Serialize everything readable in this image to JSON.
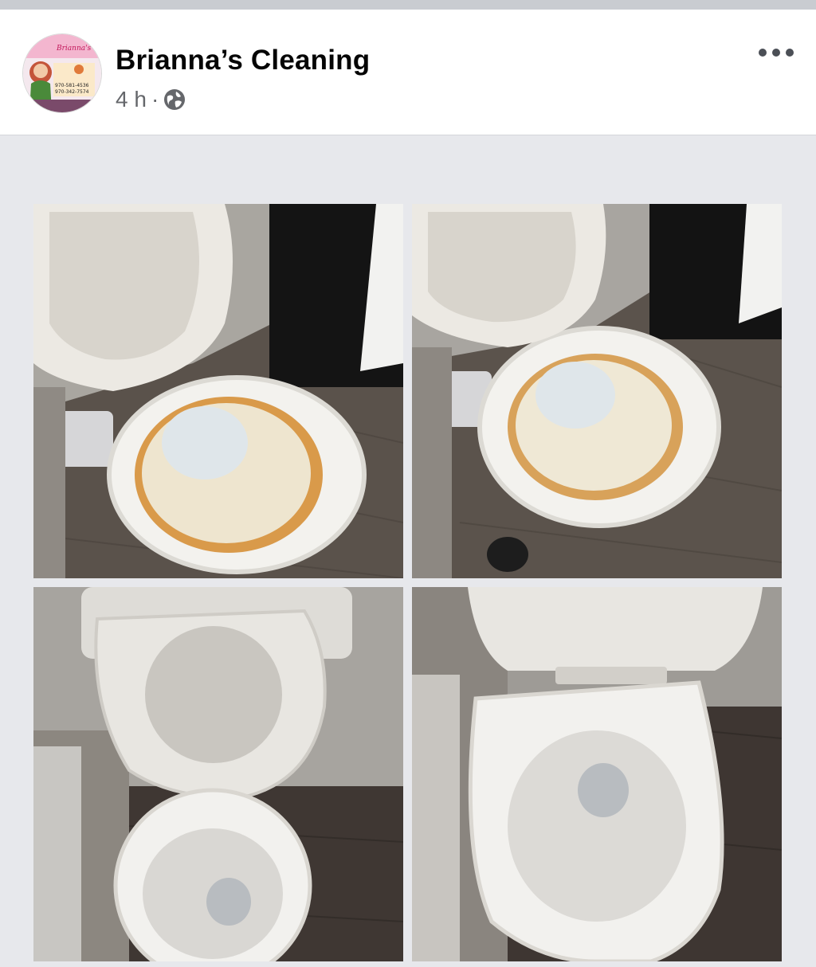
{
  "post": {
    "page_name": "Brianna’s Cleaning",
    "time": "4 h",
    "separator": "·",
    "audience_icon": "globe-icon",
    "more_icon": "more-options-icon"
  },
  "avatar_logo": {
    "title": "Brianna's Cleaning",
    "phone_1": "970-581-4536",
    "phone_2": "970-342-7574"
  },
  "photos": [
    {
      "name": "before-photo-1"
    },
    {
      "name": "before-photo-2"
    },
    {
      "name": "after-photo-1"
    },
    {
      "name": "after-photo-2"
    }
  ],
  "colors": {
    "page_name": "#050505",
    "meta": "#65676b",
    "background": "#e4e6eb"
  }
}
